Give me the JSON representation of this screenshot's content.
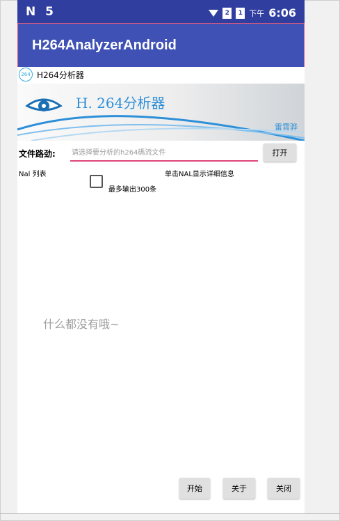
{
  "status_bar": {
    "left_icons_label": "N 5",
    "sim_badge_1": "2",
    "sim_badge_2": "1",
    "time_prefix": "下午",
    "time": "6:06"
  },
  "app_bar": {
    "title": "H264AnalyzerAndroid"
  },
  "subheader": {
    "logo_text": "264",
    "title": "H264分析器"
  },
  "banner": {
    "title": "H. 264分析器",
    "author": "雷霄骅"
  },
  "file_path": {
    "label": "文件路劲:",
    "placeholder": "请选择要分析的h264碼流文件",
    "value": "",
    "open_button": "打开"
  },
  "nal": {
    "list_label": "Nal 列表",
    "detail_hint": "单击NAL显示详细信息",
    "max_output_checkbox_label": "最多输出300条",
    "max_output_checked": false
  },
  "empty_state": {
    "text": "什么都没有哦~"
  },
  "bottom_buttons": {
    "start": "开始",
    "about": "关于",
    "close": "关闭"
  },
  "colors": {
    "status_bar": "#303f9f",
    "app_bar": "#3f51b5",
    "accent_underline": "#e0457b",
    "banner_text": "#2d8fd8",
    "button_bg": "#e0e0e0"
  }
}
